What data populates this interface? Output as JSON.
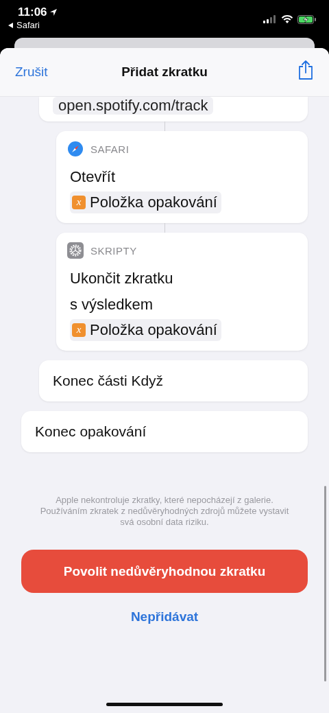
{
  "status_bar": {
    "time": "11:06",
    "back_label": "Safari"
  },
  "header": {
    "cancel": "Zrušit",
    "title": "Přidat zkratku"
  },
  "flow": {
    "end_label": "Konec opakování",
    "children": [
      {
        "kind": "if",
        "chip": "open.spotify.com/track",
        "end_label": "Konec části Když",
        "children": [
          {
            "kind": "safari",
            "app": "SAFARI",
            "lines": [
              "Otevřít"
            ],
            "variable_icon": "x",
            "variable": "Položka opakování"
          },
          {
            "kind": "scripting",
            "app": "SKRIPTY",
            "lines": [
              "Ukončit zkratku",
              "s výsledkem"
            ],
            "variable_icon": "x",
            "variable": "Položka opakování"
          }
        ]
      }
    ]
  },
  "notice": "Apple nekontroluje zkratky, které nepocházejí z galerie. Používáním zkratek z nedůvěryhodných zdrojů můžete vystavit svá osobní data riziku.",
  "allow_button": "Povolit nedůvěryhodnou zkratku",
  "decline_link": "Nepřidávat"
}
